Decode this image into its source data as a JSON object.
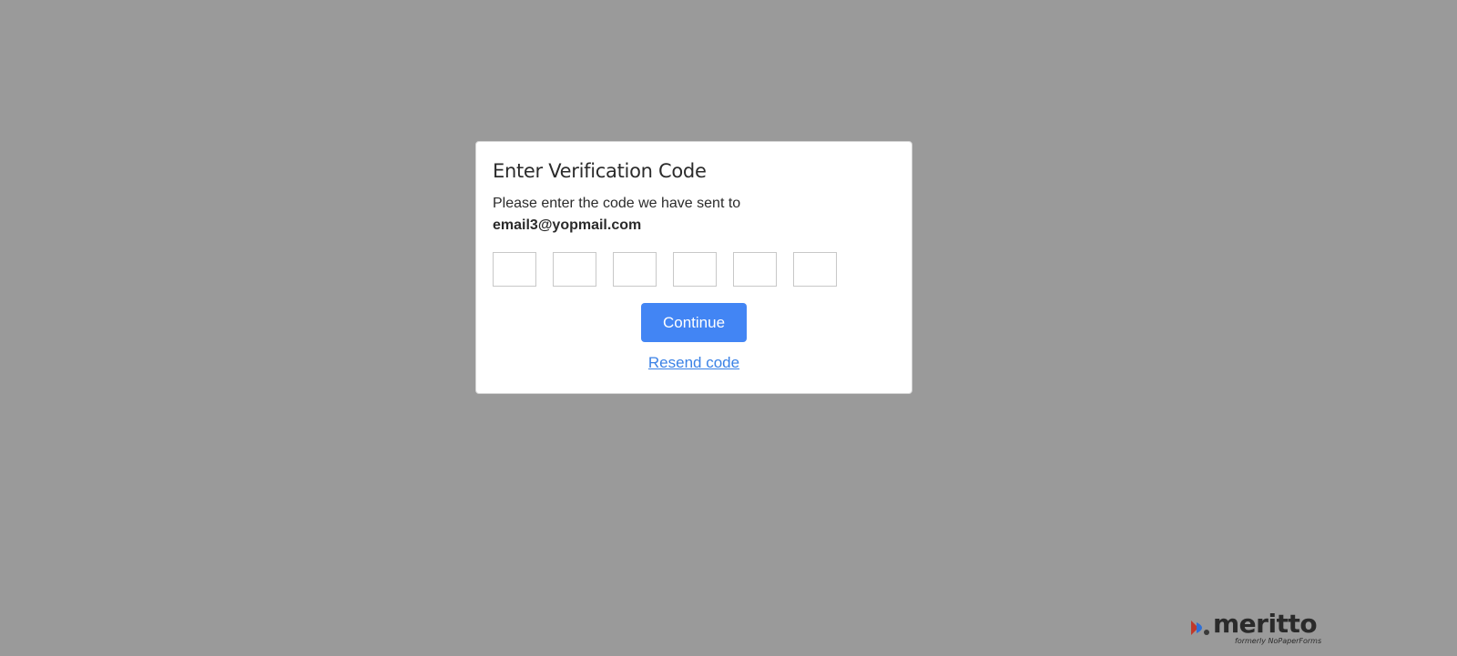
{
  "dialog": {
    "title": "Enter Verification Code",
    "message": "Please enter the code we have sent to",
    "email": "email3@yopmail.com",
    "code_digits": [
      "",
      "",
      "",
      "",
      "",
      ""
    ],
    "continue_label": "Continue",
    "resend_label": "Resend code"
  },
  "brand": {
    "name": "meritto",
    "tagline": "formerly NoPaperForms"
  },
  "colors": {
    "backdrop": "#9a9a9a",
    "primary": "#4285f4",
    "link": "#3b82e6"
  }
}
